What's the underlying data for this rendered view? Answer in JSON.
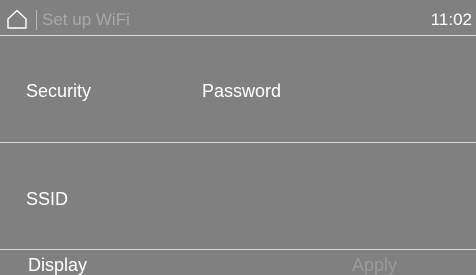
{
  "header": {
    "home_icon": "home-icon",
    "title": "Set up WiFi",
    "time": "11:02"
  },
  "rows": {
    "security": {
      "label": "Security",
      "value": "Password"
    },
    "ssid": {
      "label": "SSID"
    }
  },
  "footer": {
    "display_label": "Display",
    "apply_label": "Apply",
    "apply_enabled": false
  },
  "colors": {
    "background": "#808080",
    "divider": "#d8d8d8",
    "text": "#ffffff",
    "dimmed_text": "#a8a8a8"
  }
}
